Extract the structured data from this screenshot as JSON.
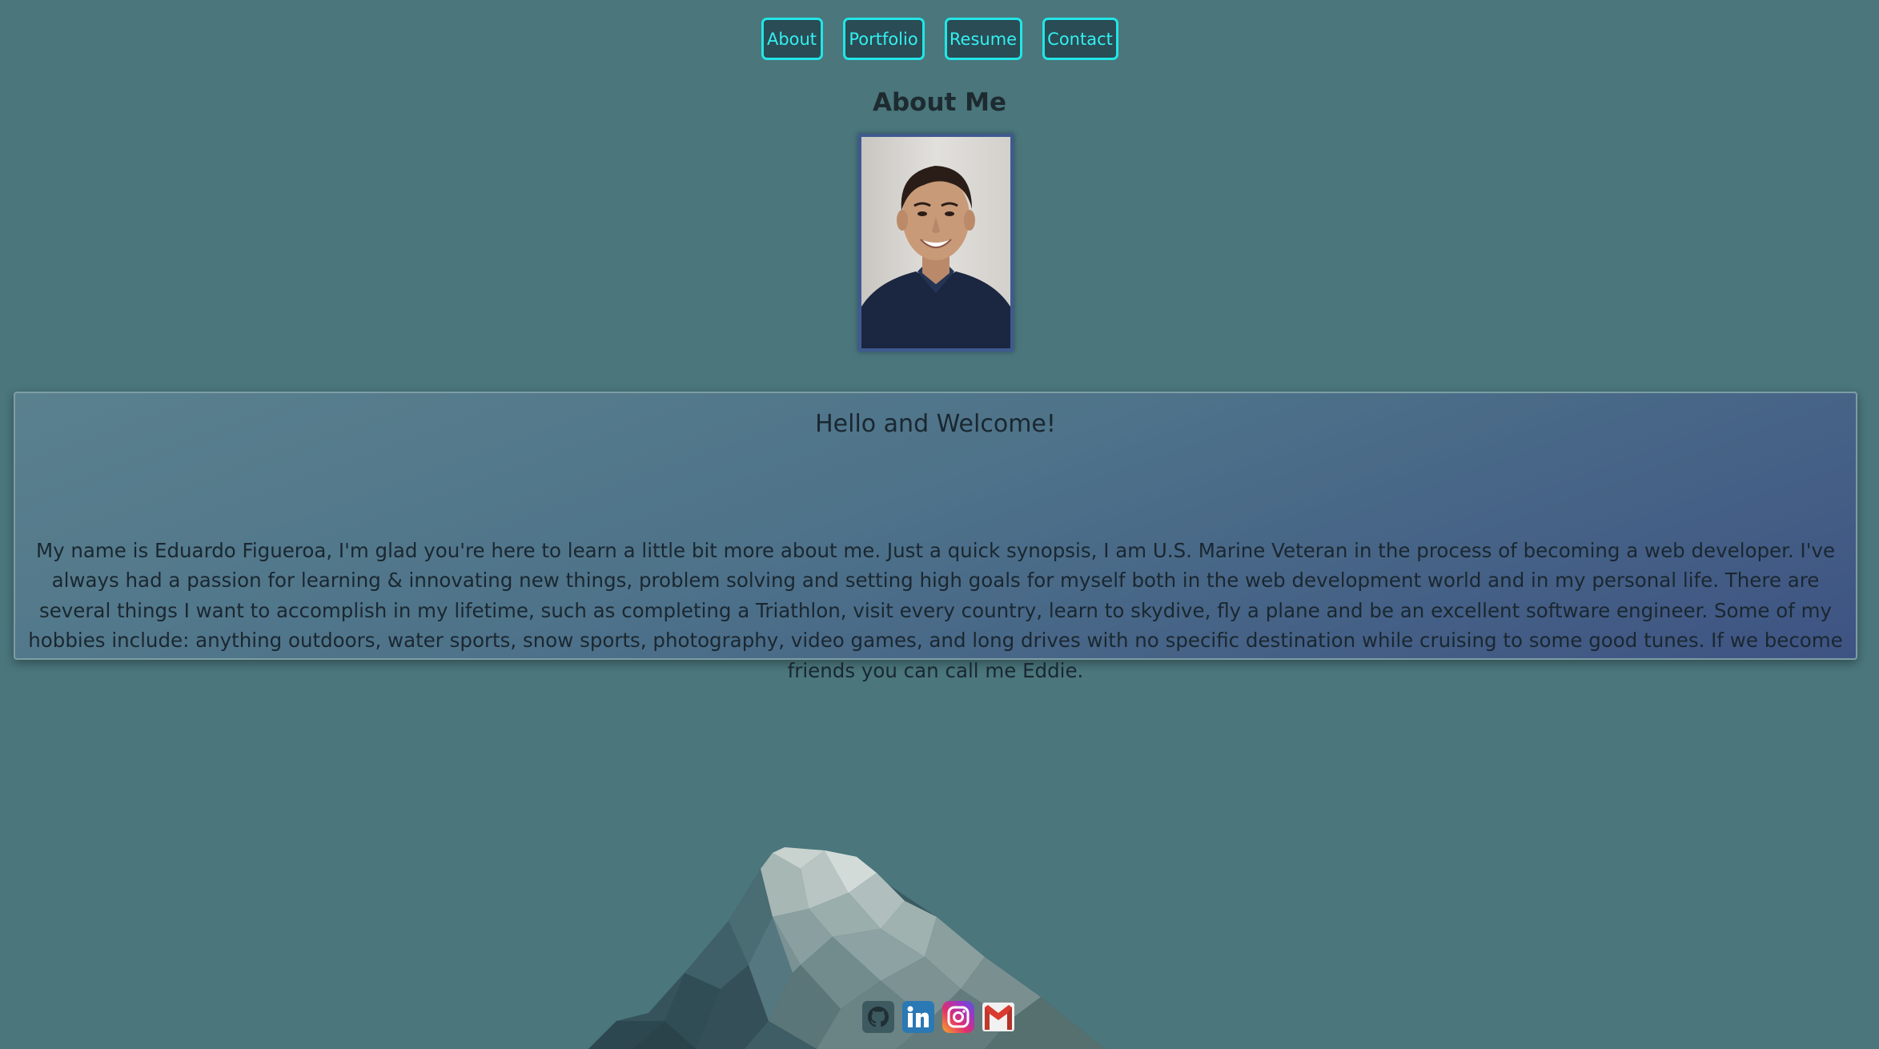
{
  "nav": {
    "items": [
      {
        "label": "About"
      },
      {
        "label": "Portfolio"
      },
      {
        "label": "Resume"
      },
      {
        "label": "Contact"
      }
    ]
  },
  "header": {
    "title": "About Me"
  },
  "card": {
    "title": "Hello and Welcome!",
    "body": "My name is Eduardo Figueroa, I'm glad you're here to learn a little bit more about me. Just a quick synopsis, I am U.S. Marine Veteran in the process of becoming a web developer. I've always had a passion for learning & innovating new things, problem solving and setting high goals for myself both in the web development world and in my personal life. There are several things I want to accomplish in my lifetime, such as completing a Triathlon, visit every country, learn to skydive, fly a plane and be an excellent software engineer. Some of my hobbies include: anything outdoors, water sports, snow sports, photography, video games, and long drives with no specific destination while cruising to some good tunes. If we become friends you can call me Eddie."
  },
  "social": {
    "icons": [
      "github-icon",
      "linkedin-icon",
      "instagram-icon",
      "gmail-icon"
    ]
  },
  "colors": {
    "background": "#4a767c",
    "nav_accent": "#22e6e6",
    "portrait_border": "#3f5a8f"
  }
}
